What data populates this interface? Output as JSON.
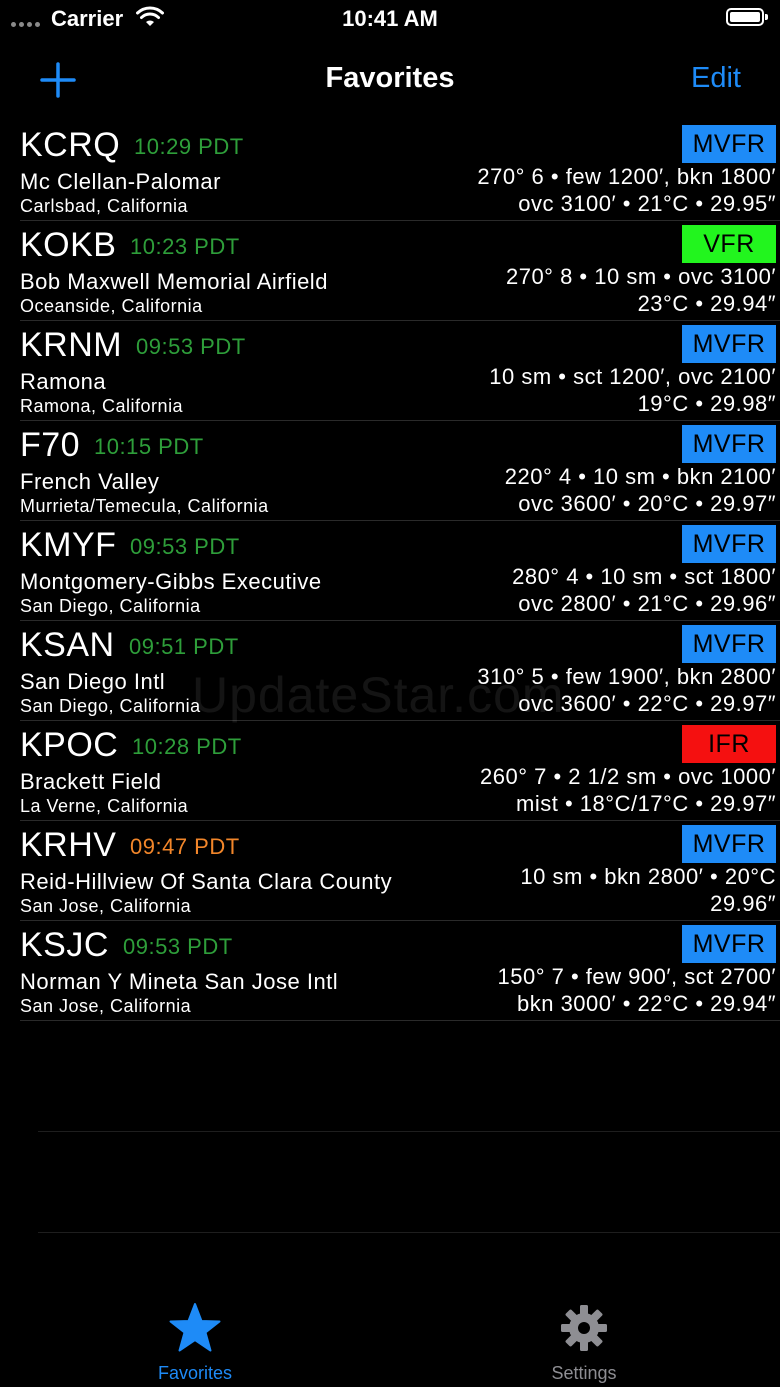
{
  "status": {
    "carrier": "Carrier",
    "time": "10:41 AM"
  },
  "nav": {
    "title": "Favorites",
    "edit_label": "Edit"
  },
  "colors": {
    "accent": "#1e8bf7",
    "mvfr": "#1e8bf7",
    "vfr": "#22f51e",
    "ifr": "#f51010",
    "time_fresh": "#2e9e3a",
    "time_stale": "#f2862a"
  },
  "stations": [
    {
      "ident": "KCRQ",
      "time": "10:29 PDT",
      "time_status": "fresh",
      "name": "Mc Clellan-Palomar",
      "city": "Carlsbad, California",
      "category": "MVFR",
      "line1": "270° 6 • few 1200′, bkn 1800′",
      "line2": "ovc 3100′ • 21°C • 29.95″"
    },
    {
      "ident": "KOKB",
      "time": "10:23 PDT",
      "time_status": "fresh",
      "name": "Bob Maxwell Memorial Airfield",
      "city": "Oceanside, California",
      "category": "VFR",
      "line1": "270° 8 • 10 sm • ovc 3100′",
      "line2": "23°C • 29.94″"
    },
    {
      "ident": "KRNM",
      "time": "09:53 PDT",
      "time_status": "fresh",
      "name": "Ramona",
      "city": "Ramona, California",
      "category": "MVFR",
      "line1": "10 sm • sct 1200′, ovc 2100′",
      "line2": "19°C • 29.98″"
    },
    {
      "ident": "F70",
      "time": "10:15 PDT",
      "time_status": "fresh",
      "name": "French Valley",
      "city": "Murrieta/Temecula, California",
      "category": "MVFR",
      "line1": "220° 4 • 10 sm • bkn 2100′",
      "line2": "ovc 3600′ • 20°C • 29.97″"
    },
    {
      "ident": "KMYF",
      "time": "09:53 PDT",
      "time_status": "fresh",
      "name": "Montgomery-Gibbs Executive",
      "city": "San Diego, California",
      "category": "MVFR",
      "line1": "280° 4 • 10 sm • sct 1800′",
      "line2": "ovc 2800′ • 21°C • 29.96″"
    },
    {
      "ident": "KSAN",
      "time": "09:51 PDT",
      "time_status": "fresh",
      "name": "San Diego Intl",
      "city": "San Diego, California",
      "category": "MVFR",
      "line1": "310° 5 • few 1900′, bkn 2800′",
      "line2": "ovc 3600′ • 22°C • 29.97″"
    },
    {
      "ident": "KPOC",
      "time": "10:28 PDT",
      "time_status": "fresh",
      "name": "Brackett Field",
      "city": "La Verne, California",
      "category": "IFR",
      "line1": "260° 7 • 2 1/2 sm • ovc 1000′",
      "line2": "mist • 18°C/17°C • 29.97″"
    },
    {
      "ident": "KRHV",
      "time": "09:47 PDT",
      "time_status": "stale",
      "name": "Reid-Hillview Of Santa Clara County",
      "city": "San Jose, California",
      "category": "MVFR",
      "line1": "10 sm • bkn 2800′ • 20°C",
      "line2": "29.96″"
    },
    {
      "ident": "KSJC",
      "time": "09:53 PDT",
      "time_status": "fresh",
      "name": "Norman Y Mineta San Jose Intl",
      "city": "San Jose, California",
      "category": "MVFR",
      "line1": "150° 7 • few 900′, sct 2700′",
      "line2": "bkn 3000′ • 22°C • 29.94″"
    }
  ],
  "watermark": "UpdateStar.com",
  "tabs": [
    {
      "label": "Favorites",
      "icon": "star-icon",
      "active": true
    },
    {
      "label": "Settings",
      "icon": "gear-icon",
      "active": false
    }
  ]
}
